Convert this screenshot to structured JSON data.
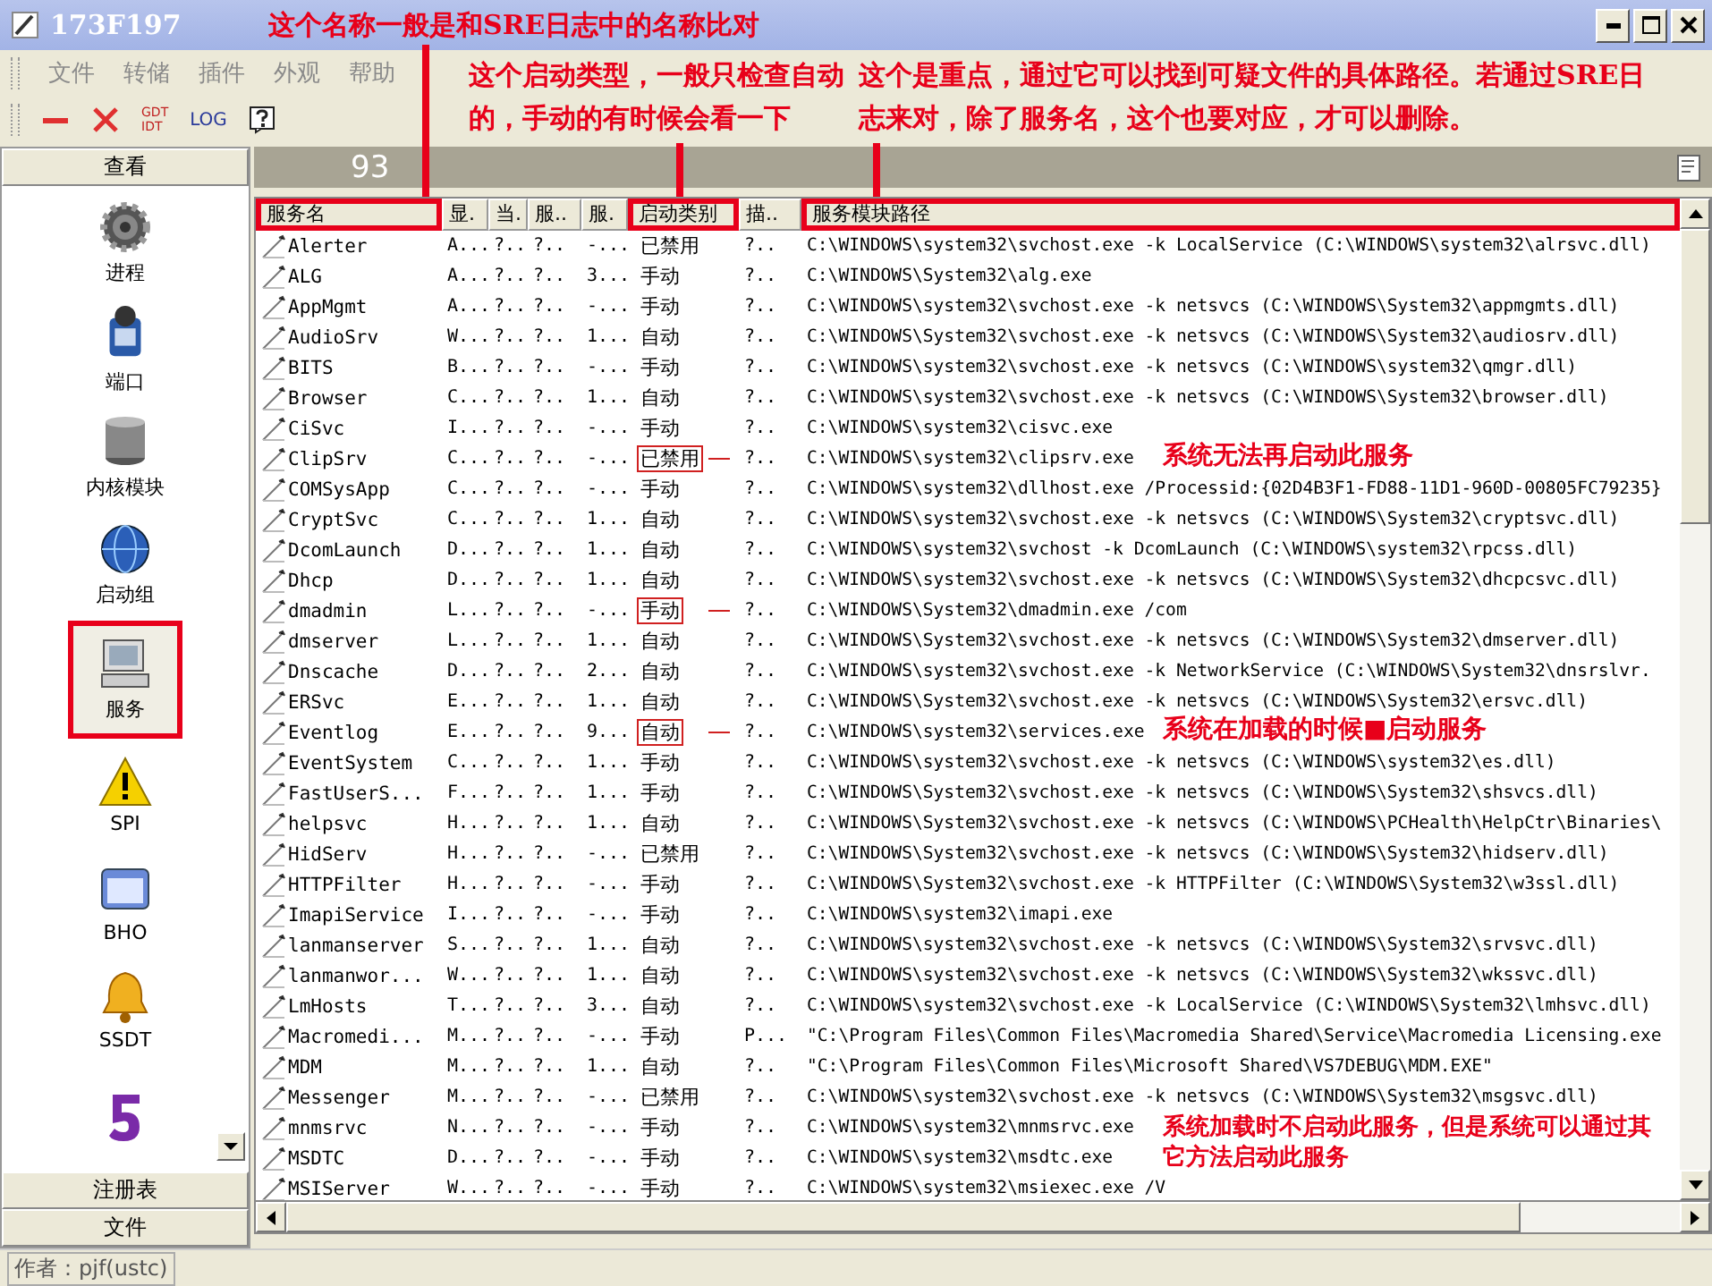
{
  "window": {
    "title": "173F197"
  },
  "menu": [
    {
      "label": "文件"
    },
    {
      "label": "转储"
    },
    {
      "label": "插件"
    },
    {
      "label": "外观"
    },
    {
      "label": "帮助"
    }
  ],
  "toolbar": [
    {
      "kind": "minus"
    },
    {
      "kind": "cross"
    },
    {
      "kind": "stack",
      "lines": [
        "GDT",
        "IDT"
      ]
    },
    {
      "kind": "text",
      "label": "LOG"
    },
    {
      "kind": "help"
    }
  ],
  "sidebar": {
    "top_button": "查看",
    "items": [
      {
        "label": "进程",
        "selected": false
      },
      {
        "label": "端口",
        "selected": false
      },
      {
        "label": "内核模块",
        "selected": false
      },
      {
        "label": "启动组",
        "selected": false
      },
      {
        "label": "服务",
        "selected": true
      },
      {
        "label": "SPI",
        "selected": false
      },
      {
        "label": "BHO",
        "selected": false
      },
      {
        "label": "SSDT",
        "selected": false
      },
      {
        "selected": false
      }
    ],
    "bottom_buttons": [
      "注册表",
      "文件"
    ]
  },
  "summary": {
    "count": "93"
  },
  "table": {
    "columns": [
      {
        "label": "服务名",
        "boxed": true
      },
      {
        "label": "显.",
        "boxed": false
      },
      {
        "label": "当.",
        "boxed": false
      },
      {
        "label": "服..",
        "boxed": false
      },
      {
        "label": "服.",
        "boxed": false
      },
      {
        "label": "启动类别",
        "boxed": true
      },
      {
        "label": "描..",
        "boxed": false
      },
      {
        "label": "服务模块路径",
        "boxed": true
      }
    ],
    "rows": [
      {
        "name": "Alerter",
        "c1": "A...",
        "c2": "?..",
        "c3": "?..",
        "c4": "-...",
        "type": "已禁用",
        "type_boxed": false,
        "desc": "?..",
        "path": "C:\\WINDOWS\\system32\\svchost.exe -k LocalService (C:\\WINDOWS\\system32\\alrsvc.dll)"
      },
      {
        "name": "ALG",
        "c1": "A...",
        "c2": "?..",
        "c3": "?..",
        "c4": "3...",
        "type": "手动",
        "type_boxed": false,
        "desc": "?..",
        "path": "C:\\WINDOWS\\System32\\alg.exe"
      },
      {
        "name": "AppMgmt",
        "c1": "A...",
        "c2": "?..",
        "c3": "?..",
        "c4": "-...",
        "type": "手动",
        "type_boxed": false,
        "desc": "?..",
        "path": "C:\\WINDOWS\\system32\\svchost.exe -k netsvcs (C:\\WINDOWS\\System32\\appmgmts.dll)"
      },
      {
        "name": "AudioSrv",
        "c1": "W...",
        "c2": "?..",
        "c3": "?..",
        "c4": "1...",
        "type": "自动",
        "type_boxed": false,
        "desc": "?..",
        "path": "C:\\WINDOWS\\System32\\svchost.exe -k netsvcs (C:\\WINDOWS\\System32\\audiosrv.dll)"
      },
      {
        "name": "BITS",
        "c1": "B...",
        "c2": "?..",
        "c3": "?..",
        "c4": "-...",
        "type": "手动",
        "type_boxed": false,
        "desc": "?..",
        "path": "C:\\WINDOWS\\system32\\svchost.exe -k netsvcs (C:\\WINDOWS\\system32\\qmgr.dll)"
      },
      {
        "name": "Browser",
        "c1": "C...",
        "c2": "?..",
        "c3": "?..",
        "c4": "1...",
        "type": "自动",
        "type_boxed": false,
        "desc": "?..",
        "path": "C:\\WINDOWS\\system32\\svchost.exe -k netsvcs (C:\\WINDOWS\\System32\\browser.dll)"
      },
      {
        "name": "CiSvc",
        "c1": "I...",
        "c2": "?..",
        "c3": "?..",
        "c4": "-...",
        "type": "手动",
        "type_boxed": false,
        "desc": "?..",
        "path": "C:\\WINDOWS\\system32\\cisvc.exe"
      },
      {
        "name": "ClipSrv",
        "c1": "C...",
        "c2": "?..",
        "c3": "?..",
        "c4": "-...",
        "type": "已禁用",
        "type_boxed": true,
        "desc": "?..",
        "path": "C:\\WINDOWS\\system32\\clipsrv.exe"
      },
      {
        "name": "COMSysApp",
        "c1": "C...",
        "c2": "?..",
        "c3": "?..",
        "c4": "-...",
        "type": "手动",
        "type_boxed": false,
        "desc": "?..",
        "path": "C:\\WINDOWS\\system32\\dllhost.exe /Processid:{02D4B3F1-FD88-11D1-960D-00805FC79235}"
      },
      {
        "name": "CryptSvc",
        "c1": "C...",
        "c2": "?..",
        "c3": "?..",
        "c4": "1...",
        "type": "自动",
        "type_boxed": false,
        "desc": "?..",
        "path": "C:\\WINDOWS\\system32\\svchost.exe -k netsvcs (C:\\WINDOWS\\System32\\cryptsvc.dll)"
      },
      {
        "name": "DcomLaunch",
        "c1": "D...",
        "c2": "?..",
        "c3": "?..",
        "c4": "1...",
        "type": "自动",
        "type_boxed": false,
        "desc": "?..",
        "path": "C:\\WINDOWS\\system32\\svchost -k DcomLaunch (C:\\WINDOWS\\system32\\rpcss.dll)"
      },
      {
        "name": "Dhcp",
        "c1": "D...",
        "c2": "?..",
        "c3": "?..",
        "c4": "1...",
        "type": "自动",
        "type_boxed": false,
        "desc": "?..",
        "path": "C:\\WINDOWS\\system32\\svchost.exe -k netsvcs (C:\\WINDOWS\\System32\\dhcpcsvc.dll)"
      },
      {
        "name": "dmadmin",
        "c1": "L...",
        "c2": "?..",
        "c3": "?..",
        "c4": "-...",
        "type": "手动",
        "type_boxed": true,
        "desc": "?..",
        "path": "C:\\WINDOWS\\System32\\dmadmin.exe /com"
      },
      {
        "name": "dmserver",
        "c1": "L...",
        "c2": "?..",
        "c3": "?..",
        "c4": "1...",
        "type": "自动",
        "type_boxed": false,
        "desc": "?..",
        "path": "C:\\WINDOWS\\System32\\svchost.exe -k netsvcs (C:\\WINDOWS\\System32\\dmserver.dll)"
      },
      {
        "name": "Dnscache",
        "c1": "D...",
        "c2": "?..",
        "c3": "?..",
        "c4": "2...",
        "type": "自动",
        "type_boxed": false,
        "desc": "?..",
        "path": "C:\\WINDOWS\\system32\\svchost.exe -k NetworkService (C:\\WINDOWS\\System32\\dnsrslvr."
      },
      {
        "name": "ERSvc",
        "c1": "E...",
        "c2": "?..",
        "c3": "?..",
        "c4": "1...",
        "type": "自动",
        "type_boxed": false,
        "desc": "?..",
        "path": "C:\\WINDOWS\\System32\\svchost.exe -k netsvcs (C:\\WINDOWS\\System32\\ersvc.dll)"
      },
      {
        "name": "Eventlog",
        "c1": "E...",
        "c2": "?..",
        "c3": "?..",
        "c4": "9...",
        "type": "自动",
        "type_boxed": true,
        "desc": "?..",
        "path": "C:\\WINDOWS\\system32\\services.exe"
      },
      {
        "name": "EventSystem",
        "c1": "C...",
        "c2": "?..",
        "c3": "?..",
        "c4": "1...",
        "type": "手动",
        "type_boxed": false,
        "desc": "?..",
        "path": "C:\\WINDOWS\\system32\\svchost.exe -k netsvcs (C:\\WINDOWS\\system32\\es.dll)"
      },
      {
        "name": "FastUserS...",
        "c1": "F...",
        "c2": "?..",
        "c3": "?..",
        "c4": "1...",
        "type": "手动",
        "type_boxed": false,
        "desc": "?..",
        "path": "C:\\WINDOWS\\System32\\svchost.exe -k netsvcs (C:\\WINDOWS\\System32\\shsvcs.dll)"
      },
      {
        "name": "helpsvc",
        "c1": "H...",
        "c2": "?..",
        "c3": "?..",
        "c4": "1...",
        "type": "自动",
        "type_boxed": false,
        "desc": "?..",
        "path": "C:\\WINDOWS\\System32\\svchost.exe -k netsvcs (C:\\WINDOWS\\PCHealth\\HelpCtr\\Binaries\\"
      },
      {
        "name": "HidServ",
        "c1": "H...",
        "c2": "?..",
        "c3": "?..",
        "c4": "-...",
        "type": "已禁用",
        "type_boxed": false,
        "desc": "?..",
        "path": "C:\\WINDOWS\\System32\\svchost.exe -k netsvcs (C:\\WINDOWS\\System32\\hidserv.dll)"
      },
      {
        "name": "HTTPFilter",
        "c1": "H...",
        "c2": "?..",
        "c3": "?..",
        "c4": "-...",
        "type": "手动",
        "type_boxed": false,
        "desc": "?..",
        "path": "C:\\WINDOWS\\System32\\svchost.exe -k HTTPFilter (C:\\WINDOWS\\System32\\w3ssl.dll)"
      },
      {
        "name": "ImapiService",
        "c1": "I...",
        "c2": "?..",
        "c3": "?..",
        "c4": "-...",
        "type": "手动",
        "type_boxed": false,
        "desc": "?..",
        "path": "C:\\WINDOWS\\system32\\imapi.exe"
      },
      {
        "name": "lanmanserver",
        "c1": "S...",
        "c2": "?..",
        "c3": "?..",
        "c4": "1...",
        "type": "自动",
        "type_boxed": false,
        "desc": "?..",
        "path": "C:\\WINDOWS\\system32\\svchost.exe -k netsvcs (C:\\WINDOWS\\System32\\srvsvc.dll)"
      },
      {
        "name": "lanmanwor...",
        "c1": "W...",
        "c2": "?..",
        "c3": "?..",
        "c4": "1...",
        "type": "自动",
        "type_boxed": false,
        "desc": "?..",
        "path": "C:\\WINDOWS\\system32\\svchost.exe -k netsvcs (C:\\WINDOWS\\System32\\wkssvc.dll)"
      },
      {
        "name": "LmHosts",
        "c1": "T...",
        "c2": "?..",
        "c3": "?..",
        "c4": "3...",
        "type": "自动",
        "type_boxed": false,
        "desc": "?..",
        "path": "C:\\WINDOWS\\system32\\svchost.exe -k LocalService (C:\\WINDOWS\\System32\\lmhsvc.dll)"
      },
      {
        "name": "Macromedi...",
        "c1": "M...",
        "c2": "?..",
        "c3": "?..",
        "c4": "-...",
        "type": "手动",
        "type_boxed": false,
        "desc": "P...",
        "path": "\"C:\\Program Files\\Common Files\\Macromedia Shared\\Service\\Macromedia Licensing.exe"
      },
      {
        "name": "MDM",
        "c1": "M...",
        "c2": "?..",
        "c3": "?..",
        "c4": "1...",
        "type": "自动",
        "type_boxed": false,
        "desc": "?..",
        "path": "\"C:\\Program Files\\Common Files\\Microsoft Shared\\VS7DEBUG\\MDM.EXE\""
      },
      {
        "name": "Messenger",
        "c1": "M...",
        "c2": "?..",
        "c3": "?..",
        "c4": "-...",
        "type": "已禁用",
        "type_boxed": false,
        "desc": "?..",
        "path": "C:\\WINDOWS\\system32\\svchost.exe -k netsvcs (C:\\WINDOWS\\System32\\msgsvc.dll)"
      },
      {
        "name": "mnmsrvc",
        "c1": "N...",
        "c2": "?..",
        "c3": "?..",
        "c4": "-...",
        "type": "手动",
        "type_boxed": false,
        "desc": "?..",
        "path": "C:\\WINDOWS\\system32\\mnmsrvc.exe"
      },
      {
        "name": "MSDTC",
        "c1": "D...",
        "c2": "?..",
        "c3": "?..",
        "c4": "-...",
        "type": "手动",
        "type_boxed": false,
        "desc": "?..",
        "path": "C:\\WINDOWS\\system32\\msdtc.exe"
      },
      {
        "name": "MSIServer",
        "c1": "W...",
        "c2": "?..",
        "c3": "?..",
        "c4": "-...",
        "type": "手动",
        "type_boxed": false,
        "desc": "?..",
        "path": "C:\\WINDOWS\\system32\\msiexec.exe /V"
      }
    ]
  },
  "annotations": [
    {
      "text": "这个名称一般是和SRE日志中的名称比对"
    },
    {
      "text": "这个启动类型，一般只检查自动的，手动的有时候会看一下"
    },
    {
      "text": "这个是重点，通过它可以找到可疑文件的具体路径。若通过SRE日志来对，除了服务名，这个也要对应，才可以删除。"
    },
    {
      "text": "系统无法再启动此服务"
    },
    {
      "text": "系统在加载的时候■启动服务"
    },
    {
      "text": "系统加载时不启动此服务，但是系统可以通过其它方法启动此服务"
    }
  ],
  "status_bar": "作者：pjf(ustc)"
}
